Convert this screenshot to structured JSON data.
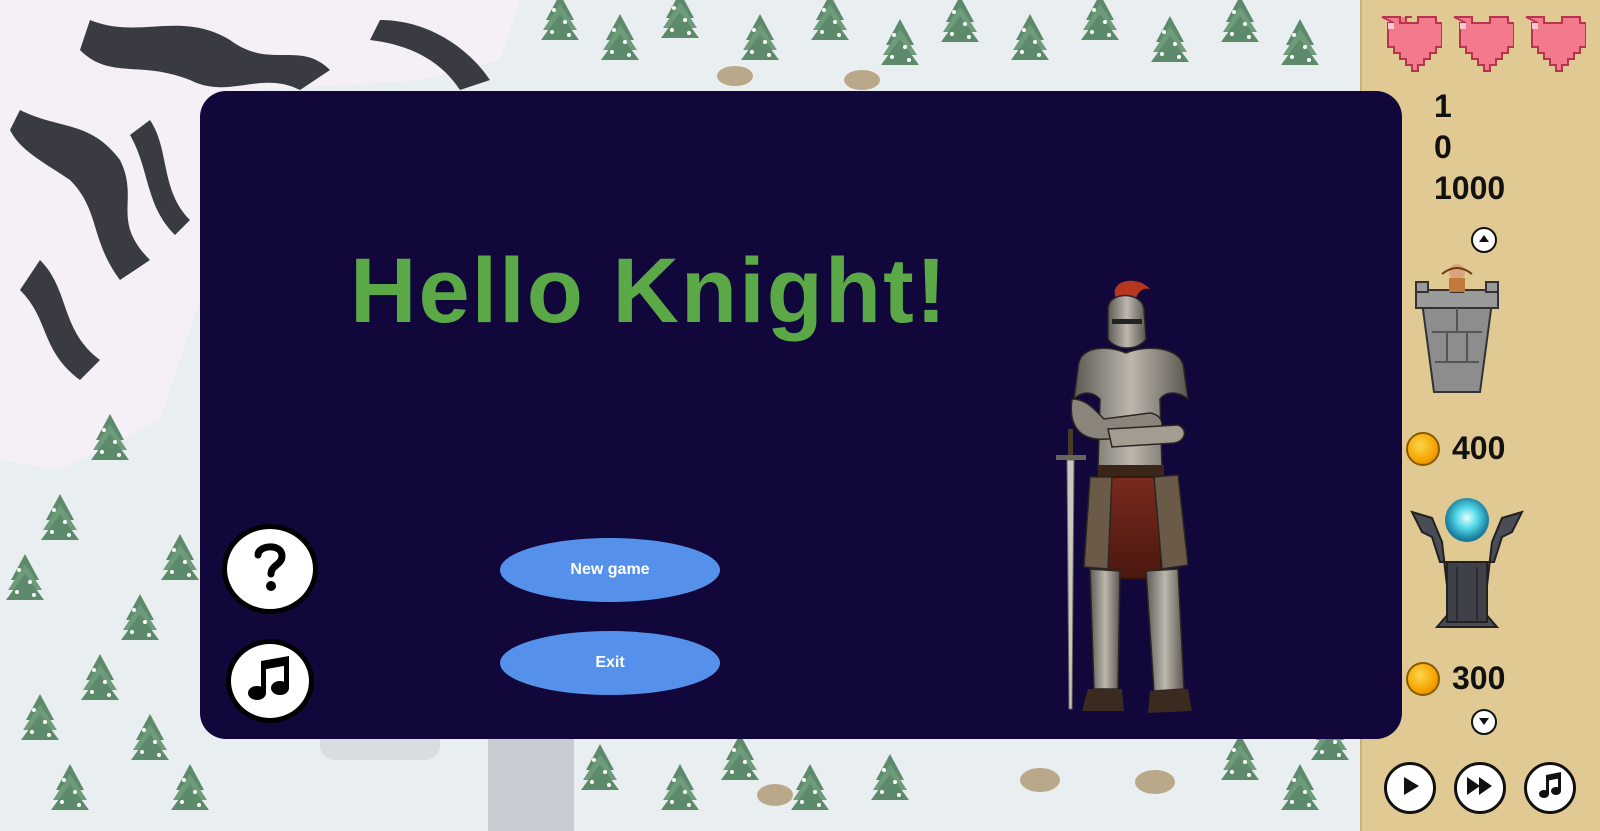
{
  "dialog": {
    "title": "Hello Knight!",
    "buttons": {
      "new_game": "New game",
      "exit": "Exit"
    },
    "help_icon": "question-icon",
    "music_icon": "music-note-icon"
  },
  "side_panel": {
    "lives": 3,
    "stats": [
      {
        "icon": "sword-icon",
        "value": "1"
      },
      {
        "icon": "gem-icon",
        "value": "0"
      },
      {
        "icon": "coin-icon",
        "value": "1000"
      }
    ],
    "towers": [
      {
        "name": "archer-tower",
        "price": "400"
      },
      {
        "name": "magic-tower",
        "price": "300"
      }
    ],
    "controls": [
      "play-icon",
      "fast-forward-icon",
      "music-note-icon"
    ]
  },
  "colors": {
    "dialog_bg": "#11073a",
    "title": "#5ba847",
    "button": "#5591ea",
    "panel": "#e0c992",
    "heart": "#f27a8c"
  }
}
